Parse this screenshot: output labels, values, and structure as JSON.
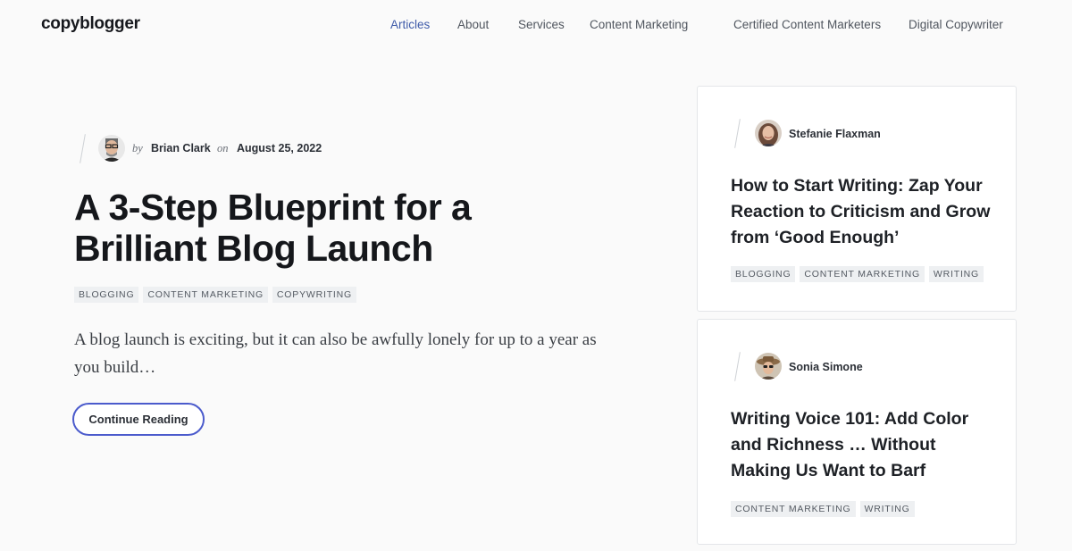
{
  "header": {
    "logo": "copyblogger",
    "nav": [
      {
        "label": "Articles",
        "active": true
      },
      {
        "label": "About",
        "active": false
      },
      {
        "label": "Services",
        "active": false
      },
      {
        "label": "Content Marketing",
        "active": false
      },
      {
        "label": "Certified Content Marketers",
        "active": false
      },
      {
        "label": "Digital Copywriter",
        "active": false
      }
    ]
  },
  "main": {
    "by": "by",
    "author": "Brian Clark",
    "on": "on",
    "date": "August 25, 2022",
    "title": "A 3-Step Blueprint for a Brilliant Blog Launch",
    "tags": [
      "BLOGGING",
      "CONTENT MARKETING",
      "COPYWRITING"
    ],
    "excerpt": "A blog launch is exciting, but it can also be awfully lonely for up to a year as you build…",
    "button_label": "Continue Reading"
  },
  "sidebar": {
    "cards": [
      {
        "author": "Stefanie Flaxman",
        "title": "How to Start Writing: Zap Your Reaction to Criticism and Grow from ‘Good Enough’",
        "tags": [
          "BLOGGING",
          "CONTENT MARKETING",
          "WRITING"
        ]
      },
      {
        "author": "Sonia Simone",
        "title": "Writing Voice 101: Add Color and Richness … Without Making Us Want to Barf",
        "tags": [
          "CONTENT MARKETING",
          "WRITING"
        ]
      }
    ]
  },
  "colors": {
    "nav_active": "#3f5ba9",
    "button_border": "#4b5bcc",
    "tag_bg": "#eef0f2"
  }
}
